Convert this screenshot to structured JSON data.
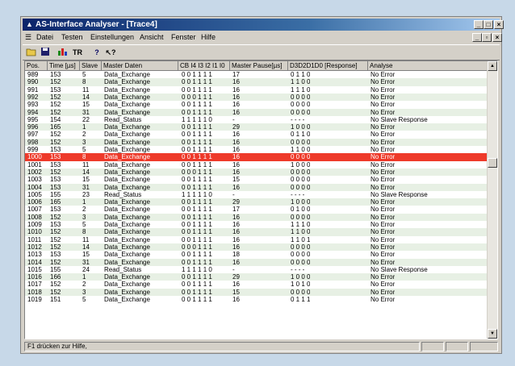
{
  "window": {
    "title": "AS-Interface Analyser - [Trace4]"
  },
  "menu": [
    "Datei",
    "Testen",
    "Einstellungen",
    "Ansicht",
    "Fenster",
    "Hilfe"
  ],
  "toolbar": {
    "tr_label": "TR",
    "help_label": "?",
    "context_help_label": "?"
  },
  "columns": [
    "Pos.",
    "Time [µs]",
    "Slave",
    "Master Daten",
    "CB I4  I3  I2  I1  I0",
    "Master Pause[µs]",
    "D3D2D1D0 [Response]",
    "Analyse"
  ],
  "rows": [
    [
      "989",
      "153",
      "5",
      "Data_Exchange",
      "0 0 1 1 1 1",
      "17",
      "0 1 1 0",
      "No Error"
    ],
    [
      "990",
      "152",
      "8",
      "Data_Exchange",
      "0 0 1 1 1 1",
      "16",
      "1 1 0 0",
      "No Error"
    ],
    [
      "991",
      "153",
      "11",
      "Data_Exchange",
      "0 0 1 1 1 1",
      "16",
      "1 1 1 0",
      "No Error"
    ],
    [
      "992",
      "152",
      "14",
      "Data_Exchange",
      "0 0 0 1 1 1",
      "16",
      "0 0 0 0",
      "No Error"
    ],
    [
      "993",
      "152",
      "15",
      "Data_Exchange",
      "0 0 1 1 1 1",
      "16",
      "0 0 0 0",
      "No Error"
    ],
    [
      "994",
      "152",
      "31",
      "Data_Exchange",
      "0 0 1 1 1 1",
      "16",
      "0 0 0 0",
      "No Error"
    ],
    [
      "995",
      "154",
      "22",
      "Read_Status",
      "1 1 1 1 1 0",
      "-",
      "- - - -",
      "No Slave Response"
    ],
    [
      "996",
      "165",
      "1",
      "Data_Exchange",
      "0 0 1 1 1 1",
      "29",
      "1 0 0 0",
      "No Error"
    ],
    [
      "997",
      "152",
      "2",
      "Data_Exchange",
      "0 0 1 1 1 1",
      "16",
      "0 1 1 0",
      "No Error"
    ],
    [
      "998",
      "152",
      "3",
      "Data_Exchange",
      "0 0 1 1 1 1",
      "16",
      "0 0 0 0",
      "No Error"
    ],
    [
      "999",
      "153",
      "5",
      "Data_Exchange",
      "0 0 1 1 1 1",
      "16",
      "1 1 0 0",
      "No Error"
    ],
    [
      "1000",
      "153",
      "8",
      "Data_Exchange",
      "0 0 1 1 1 1",
      "16",
      "0 0 0 0",
      "No Error"
    ],
    [
      "1001",
      "153",
      "11",
      "Data_Exchange",
      "0 0 1 1 1 1",
      "16",
      "1 0 0 0",
      "No Error"
    ],
    [
      "1002",
      "152",
      "14",
      "Data_Exchange",
      "0 0 0 1 1 1",
      "16",
      "0 0 0 0",
      "No Error"
    ],
    [
      "1003",
      "153",
      "15",
      "Data_Exchange",
      "0 0 1 1 1 1",
      "15",
      "0 0 0 0",
      "No Error"
    ],
    [
      "1004",
      "153",
      "31",
      "Data_Exchange",
      "0 0 1 1 1 1",
      "16",
      "0 0 0 0",
      "No Error"
    ],
    [
      "1005",
      "155",
      "23",
      "Read_Status",
      "1 1 1 1 1 0",
      "-",
      "- - - -",
      "No Slave Response"
    ],
    [
      "1006",
      "165",
      "1",
      "Data_Exchange",
      "0 0 1 1 1 1",
      "29",
      "1 0 0 0",
      "No Error"
    ],
    [
      "1007",
      "153",
      "2",
      "Data_Exchange",
      "0 0 1 1 1 1",
      "17",
      "0 1 0 0",
      "No Error"
    ],
    [
      "1008",
      "152",
      "3",
      "Data_Exchange",
      "0 0 1 1 1 1",
      "16",
      "0 0 0 0",
      "No Error"
    ],
    [
      "1009",
      "153",
      "5",
      "Data_Exchange",
      "0 0 1 1 1 1",
      "16",
      "1 1 1 0",
      "No Error"
    ],
    [
      "1010",
      "152",
      "8",
      "Data_Exchange",
      "0 0 1 1 1 1",
      "16",
      "1 1 0 0",
      "No Error"
    ],
    [
      "1011",
      "152",
      "11",
      "Data_Exchange",
      "0 0 1 1 1 1",
      "16",
      "1 1 0 1",
      "No Error"
    ],
    [
      "1012",
      "152",
      "14",
      "Data_Exchange",
      "0 0 0 1 1 1",
      "16",
      "0 0 0 0",
      "No Error"
    ],
    [
      "1013",
      "153",
      "15",
      "Data_Exchange",
      "0 0 1 1 1 1",
      "18",
      "0 0 0 0",
      "No Error"
    ],
    [
      "1014",
      "152",
      "31",
      "Data_Exchange",
      "0 0 1 1 1 1",
      "16",
      "0 0 0 0",
      "No Error"
    ],
    [
      "1015",
      "155",
      "24",
      "Read_Status",
      "1 1 1 1 1 0",
      "-",
      "- - - -",
      "No Slave Response"
    ],
    [
      "1016",
      "166",
      "1",
      "Data_Exchange",
      "0 0 1 1 1 1",
      "29",
      "1 0 0 0",
      "No Error"
    ],
    [
      "1017",
      "152",
      "2",
      "Data_Exchange",
      "0 0 1 1 1 1",
      "16",
      "1 0 1 0",
      "No Error"
    ],
    [
      "1018",
      "152",
      "3",
      "Data_Exchange",
      "0 0 1 1 1 1",
      "15",
      "0 0 0 0",
      "No Error"
    ],
    [
      "1019",
      "151",
      "5",
      "Data_Exchange",
      "0 0 1 1 1 1",
      "16",
      "0 1 1 1",
      "No Error"
    ]
  ],
  "selected_row_index": 11,
  "colors": {
    "selected_row": "#ee3a2a",
    "alt_row": "#e7f0e4",
    "title_start": "#0a246a",
    "title_end": "#a6caf0"
  },
  "status": {
    "text": "F1 drücken zur Hilfe,"
  }
}
